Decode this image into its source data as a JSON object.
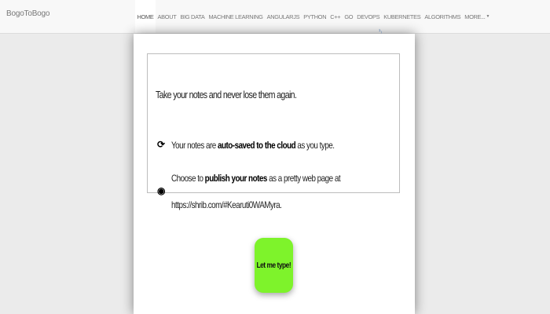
{
  "navbar": {
    "brand": "BogoToBogo",
    "items": [
      {
        "label": "HOME",
        "active": true
      },
      {
        "label": "ABOUT"
      },
      {
        "label": "BIG DATA"
      },
      {
        "label": "MACHINE LEARNING"
      },
      {
        "label": "ANGULARJS"
      },
      {
        "label": "PYTHON"
      },
      {
        "label": "C++"
      },
      {
        "label": "GO"
      },
      {
        "label": "DEVOPS"
      },
      {
        "label": "KUBERNETES"
      },
      {
        "label": "ALGORITHMS"
      },
      {
        "label": "MORE..."
      }
    ]
  },
  "modal": {
    "top_glyph": "¹₎",
    "headline": "Take your notes and never lose them again.",
    "feature1": {
      "icon": "sync-icon",
      "pre": "Your notes are ",
      "bold": "auto-saved to the cloud",
      "post": " as you type."
    },
    "feature2": {
      "icon": "globe-icon",
      "pre": "Choose to ",
      "bold": "publish your notes",
      "post": " as a pretty web page at",
      "url": "https://shrib.com/#Kearuti0WAMyra."
    },
    "button_label": "Let me type!"
  },
  "colors": {
    "button": "#7ef32b",
    "page_background": "#ebebeb"
  }
}
